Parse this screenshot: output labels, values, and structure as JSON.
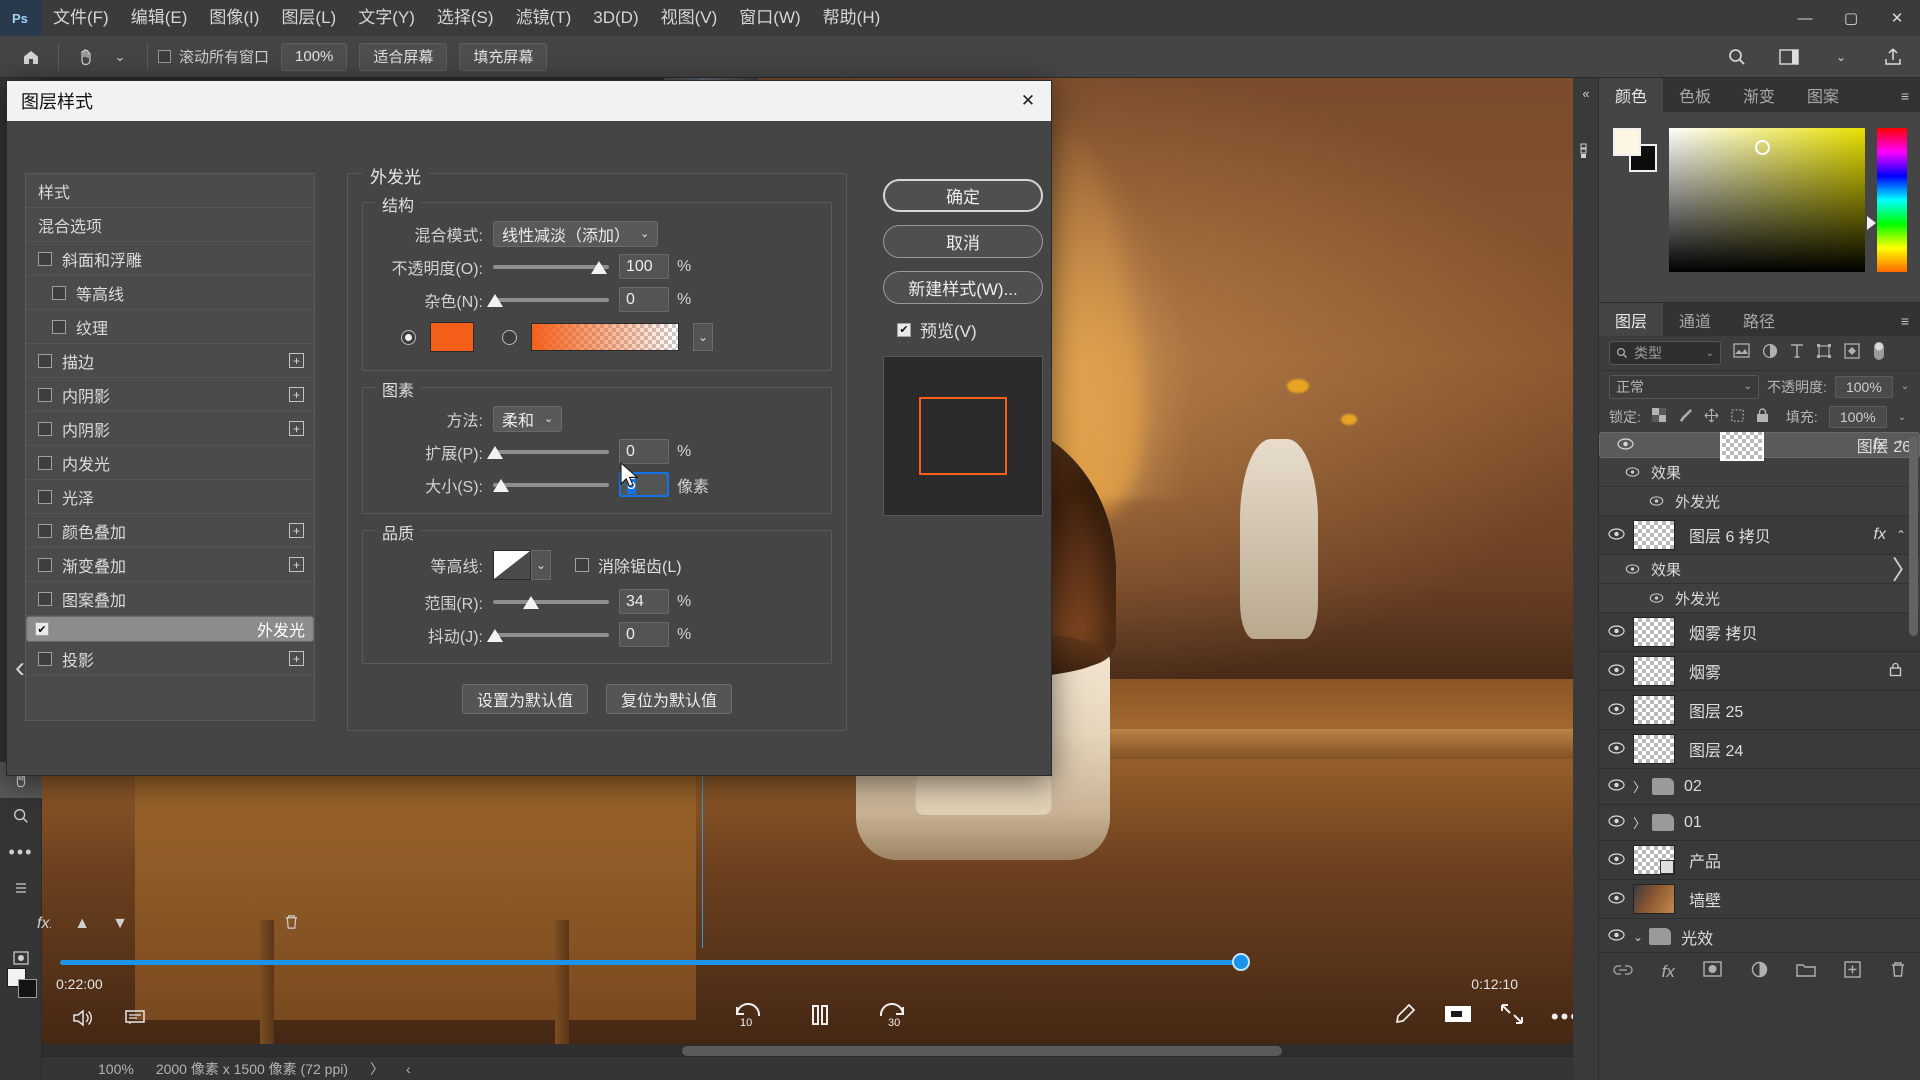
{
  "app": {
    "logo": "Ps",
    "menus": [
      "文件(F)",
      "编辑(E)",
      "图像(I)",
      "图层(L)",
      "文字(Y)",
      "选择(S)",
      "滤镜(T)",
      "3D(D)",
      "视图(V)",
      "窗口(W)",
      "帮助(H)"
    ],
    "window_controls": {
      "minimize": "—",
      "maximize": "▢",
      "close": "✕"
    }
  },
  "options_bar": {
    "home_icon": "home-icon",
    "tool_icon": "hand-tool-icon",
    "tool_caret": "⌄",
    "scroll_all_label": "滚动所有窗口",
    "zoom_value": "100%",
    "fit_screen": "适合屏幕",
    "fill_screen": "填充屏幕",
    "search_icon": "search-icon",
    "workspace_icon": "workspace-icon",
    "share_icon": "share-icon"
  },
  "status_bar": {
    "zoom": "100%",
    "doc_size": "2000 像素 x 1500 像素 (72 ppi)",
    "chevron_right": "〉",
    "chevron_left": "‹"
  },
  "timeline": {
    "current_time": "0:22:00",
    "total_time": "0:12:10",
    "back_10": "10",
    "forward_30": "30",
    "play_pause": "pause-icon",
    "audio_icon": "speaker-icon",
    "comment_icon": "comment-icon",
    "pencil_icon": "pencil-icon",
    "capture_icon": "capture-icon",
    "collapse_icon": "collapse-icon",
    "more_icon": "more-icon"
  },
  "dialog": {
    "title": "图层样式",
    "close": "✕",
    "style_list": [
      {
        "label": "样式",
        "type": "header"
      },
      {
        "label": "混合选项",
        "type": "header"
      },
      {
        "label": "斜面和浮雕",
        "type": "check",
        "checked": false,
        "indent": false,
        "plus": false
      },
      {
        "label": "等高线",
        "type": "check",
        "checked": false,
        "indent": true,
        "plus": false
      },
      {
        "label": "纹理",
        "type": "check",
        "checked": false,
        "indent": true,
        "plus": false
      },
      {
        "label": "描边",
        "type": "check",
        "checked": false,
        "indent": false,
        "plus": true
      },
      {
        "label": "内阴影",
        "type": "check",
        "checked": false,
        "indent": false,
        "plus": true
      },
      {
        "label": "内阴影",
        "type": "check",
        "checked": false,
        "indent": false,
        "plus": true
      },
      {
        "label": "内发光",
        "type": "check",
        "checked": false,
        "indent": false,
        "plus": false
      },
      {
        "label": "光泽",
        "type": "check",
        "checked": false,
        "indent": false,
        "plus": false
      },
      {
        "label": "颜色叠加",
        "type": "check",
        "checked": false,
        "indent": false,
        "plus": true
      },
      {
        "label": "渐变叠加",
        "type": "check",
        "checked": false,
        "indent": false,
        "plus": true
      },
      {
        "label": "图案叠加",
        "type": "check",
        "checked": false,
        "indent": false,
        "plus": false
      },
      {
        "label": "外发光",
        "type": "check",
        "checked": true,
        "indent": false,
        "plus": false,
        "selected": true
      },
      {
        "label": "投影",
        "type": "check",
        "checked": false,
        "indent": false,
        "plus": true
      }
    ],
    "style_footer": {
      "fx_icon": "fx-icon",
      "up_icon": "▲",
      "down_icon": "▼",
      "trash_icon": "trash-icon"
    },
    "section_title": "外发光",
    "structure": {
      "legend": "结构",
      "blend_mode_label": "混合模式:",
      "blend_mode_value": "线性减淡（添加）",
      "opacity_label": "不透明度(O):",
      "opacity_value": "100",
      "opacity_unit": "%",
      "noise_label": "杂色(N):",
      "noise_value": "0",
      "noise_unit": "%",
      "color_mode_selected": "solid",
      "solid_color": "#f4601a",
      "gradient_caret": "⌄"
    },
    "elements": {
      "legend": "图素",
      "technique_label": "方法:",
      "technique_value": "柔和",
      "spread_label": "扩展(P):",
      "spread_value": "0",
      "spread_unit": "%",
      "size_label": "大小(S):",
      "size_value": "5",
      "size_unit": "像素"
    },
    "quality": {
      "legend": "品质",
      "contour_label": "等高线:",
      "antialias_label": "消除锯齿(L)",
      "antialias_checked": false,
      "range_label": "范围(R):",
      "range_value": "34",
      "range_unit": "%",
      "jitter_label": "抖动(J):",
      "jitter_value": "0",
      "jitter_unit": "%"
    },
    "default_buttons": {
      "set_default": "设置为默认值",
      "reset_default": "复位为默认值"
    },
    "buttons": {
      "ok": "确定",
      "cancel": "取消",
      "new_style": "新建样式(W)..."
    },
    "preview": {
      "label": "预览(V)",
      "checked": true
    }
  },
  "color_panel": {
    "tabs": [
      "颜色",
      "色板",
      "渐变",
      "图案"
    ],
    "active_tab": "颜色",
    "menu_icon": "panel-menu-icon",
    "foreground": "#fdf6e3",
    "background": "#0d0d0d"
  },
  "layers_panel": {
    "tabs": [
      "图层",
      "通道",
      "路径"
    ],
    "active_tab": "图层",
    "menu_icon": "panel-menu-icon",
    "filter_placeholder": "类型",
    "filter_icons": [
      "pixel-filter-icon",
      "adjustment-filter-icon",
      "type-filter-icon",
      "shape-filter-icon",
      "smart-object-filter-icon"
    ],
    "filter_toggle": "filter-toggle-icon",
    "blend_mode": "正常",
    "opacity_label": "不透明度:",
    "opacity_value": "100%",
    "lock_label": "锁定:",
    "lock_icons": [
      "lock-transparency-icon",
      "lock-image-icon",
      "lock-position-icon",
      "lock-artboard-icon",
      "lock-all-icon"
    ],
    "fill_label": "填充:",
    "fill_value": "100%",
    "layers": [
      {
        "name": "图层 26",
        "visible": true,
        "selected": true,
        "fx": "fx",
        "caret": "⌃",
        "thumb": "transparent",
        "effects": [
          {
            "name": "效果"
          },
          {
            "name": "外发光"
          }
        ]
      },
      {
        "name": "图层 6 拷贝",
        "visible": true,
        "selected": false,
        "fx": "fx",
        "caret": "⌃",
        "thumb": "transparent",
        "effects": [
          {
            "name": "效果"
          },
          {
            "name": "外发光"
          }
        ]
      },
      {
        "name": "烟雾 拷贝",
        "visible": true,
        "selected": false,
        "thumb": "transparent",
        "effects": []
      },
      {
        "name": "烟雾",
        "visible": true,
        "selected": false,
        "locked": true,
        "thumb": "transparent",
        "effects": []
      },
      {
        "name": "图层 25",
        "visible": true,
        "selected": false,
        "thumb": "transparent",
        "effects": []
      },
      {
        "name": "图层 24",
        "visible": true,
        "selected": false,
        "thumb": "transparent",
        "effects": []
      },
      {
        "name": "02",
        "visible": true,
        "selected": false,
        "type": "group",
        "collapsed": true,
        "effects": []
      },
      {
        "name": "01",
        "visible": true,
        "selected": false,
        "type": "group",
        "collapsed": true,
        "effects": []
      },
      {
        "name": "产品",
        "visible": true,
        "selected": false,
        "thumb": "smart",
        "effects": []
      },
      {
        "name": "墙壁",
        "visible": true,
        "selected": false,
        "thumb": "image",
        "effects": []
      },
      {
        "name": "光效",
        "visible": true,
        "selected": false,
        "type": "group",
        "collapsed": false,
        "effects": []
      }
    ],
    "footer_icons": [
      "link-icon",
      "fx-icon",
      "mask-icon",
      "adjustment-icon",
      "group-icon",
      "new-layer-icon",
      "delete-icon"
    ]
  },
  "toolbar": {
    "tools": [
      "move-tool-icon",
      "marquee-tool-icon",
      "lasso-tool-icon",
      "quick-select-tool-icon",
      "crop-tool-icon",
      "frame-tool-icon",
      "eyedropper-tool-icon",
      "healing-brush-icon",
      "brush-tool-icon",
      "clone-stamp-icon",
      "history-brush-icon",
      "eraser-tool-icon",
      "gradient-tool-icon",
      "blur-tool-icon",
      "dodge-tool-icon",
      "pen-tool-icon",
      "type-tool-icon",
      "path-select-icon",
      "shape-tool-icon",
      "hand-tool-icon",
      "zoom-tool-icon",
      "more-tools-icon"
    ],
    "foreground_color": "#f2f2f2",
    "background_color": "#141414"
  }
}
